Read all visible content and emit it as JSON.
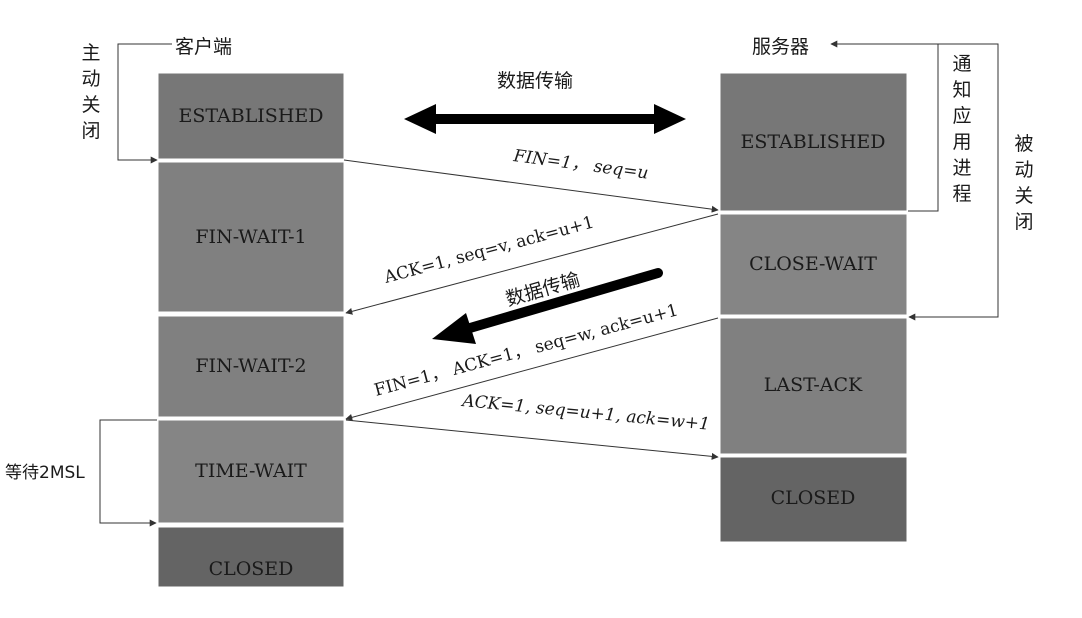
{
  "client": {
    "title": "客户端",
    "active_close": [
      "主",
      "动",
      "关",
      "闭"
    ],
    "wait_label": "等待2MSL",
    "states": [
      "ESTABLISHED",
      "FIN-WAIT-1",
      "FIN-WAIT-2",
      "TIME-WAIT",
      "CLOSED"
    ]
  },
  "server": {
    "title": "服务器",
    "notify_app": [
      "通",
      "知",
      "应",
      "用",
      "进",
      "程"
    ],
    "passive_close": [
      "被",
      "动",
      "关",
      "闭"
    ],
    "states": [
      "ESTABLISHED",
      "CLOSE-WAIT",
      "LAST-ACK",
      "CLOSED"
    ]
  },
  "transfer_top": "数据传输",
  "transfer_mid": "数据传输",
  "messages": {
    "fin1": "FIN=1， seq=u",
    "ack1": "ACK=1, seq=v, ack=u+1",
    "fin2": "FIN=1， ACK=1， seq=w, ack=u+1",
    "ack2": "ACK=1, seq=u+1, ack=w+1"
  },
  "colors": {
    "established": "#777777",
    "wait": "#888888",
    "closed": "#666666",
    "arrow": "#000000"
  }
}
